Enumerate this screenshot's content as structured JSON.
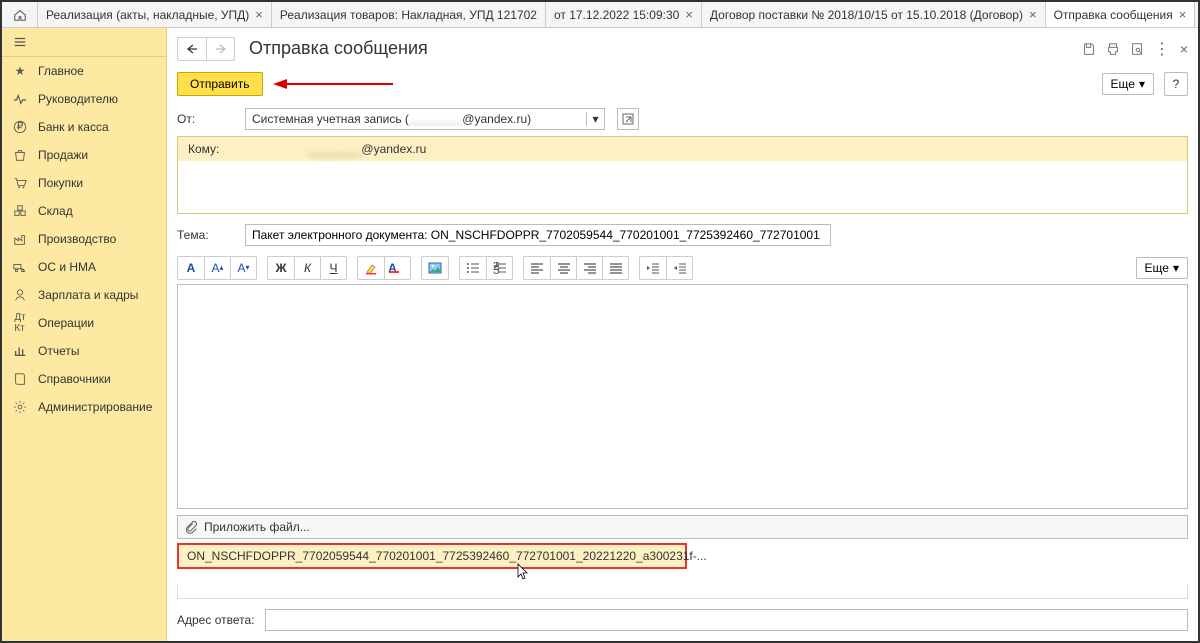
{
  "tabs": [
    {
      "label": "Реализация (акты, накладные, УПД)"
    },
    {
      "label": "Реализация товаров: Накладная, УПД 121702"
    },
    {
      "label": "от 17.12.2022 15:09:30"
    },
    {
      "label": "Договор поставки № 2018/10/15 от 15.10.2018 (Договор)"
    },
    {
      "label": "Отправка сообщения",
      "active": true
    }
  ],
  "sidebar": {
    "items": [
      {
        "key": "main",
        "label": "Главное"
      },
      {
        "key": "leader",
        "label": "Руководителю"
      },
      {
        "key": "bank",
        "label": "Банк и касса"
      },
      {
        "key": "sales",
        "label": "Продажи"
      },
      {
        "key": "purchases",
        "label": "Покупки"
      },
      {
        "key": "warehouse",
        "label": "Склад"
      },
      {
        "key": "production",
        "label": "Производство"
      },
      {
        "key": "assets",
        "label": "ОС и НМА"
      },
      {
        "key": "payroll",
        "label": "Зарплата и кадры"
      },
      {
        "key": "operations",
        "label": "Операции"
      },
      {
        "key": "reports",
        "label": "Отчеты"
      },
      {
        "key": "refs",
        "label": "Справочники"
      },
      {
        "key": "admin",
        "label": "Администрирование"
      }
    ]
  },
  "page": {
    "title": "Отправка сообщения",
    "send_label": "Отправить",
    "more_label": "Еще",
    "from_label": "От:",
    "from_prefix": "Системная учетная запись (",
    "from_masked": "________",
    "from_suffix": "@yandex.ru)",
    "to_label": "Кому:",
    "to_masked": "________",
    "to_suffix": "@yandex.ru",
    "subject_label": "Тема:",
    "subject_value": "Пакет электронного документа: ON_NSCHFDOPPR_7702059544_770201001_7725392460_772701001",
    "attach_label": "Приложить файл...",
    "attachment_name": "ON_NSCHFDOPPR_7702059544_770201001_7725392460_772701001_20221220_a300231f-...",
    "replyto_label": "Адрес ответа:",
    "replyto_value": ""
  },
  "toolbar": {
    "more": "Еще"
  }
}
